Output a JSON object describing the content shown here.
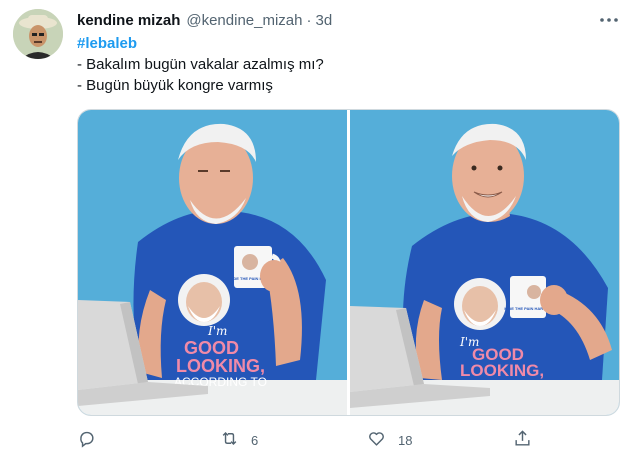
{
  "tweet": {
    "display_name": "kendine mizah",
    "handle": "@kendine_mizah",
    "separator": "·",
    "time": "3d",
    "hashtag": "#lebaleb",
    "lines": [
      "- Bakalım bugün vakalar azalmış mı?",
      "- Bugün büyük kongre varmış"
    ]
  },
  "media": {
    "shirt_text_1": "I'm",
    "shirt_text_2": "GOOD",
    "shirt_text_3": "LOOKING,",
    "shirt_text_4": "ACCORDING TO",
    "mug_text": "HIDE THE PAIN HAROLD"
  },
  "actions": {
    "reply_icon": "reply-icon",
    "retweet_icon": "retweet-icon",
    "retweet_count": "6",
    "like_icon": "heart-icon",
    "like_count": "18",
    "share_icon": "share-icon"
  },
  "colors": {
    "accent": "#1d9bf0",
    "background_blue": "#55aed9",
    "shirt_blue": "#2456b8"
  }
}
